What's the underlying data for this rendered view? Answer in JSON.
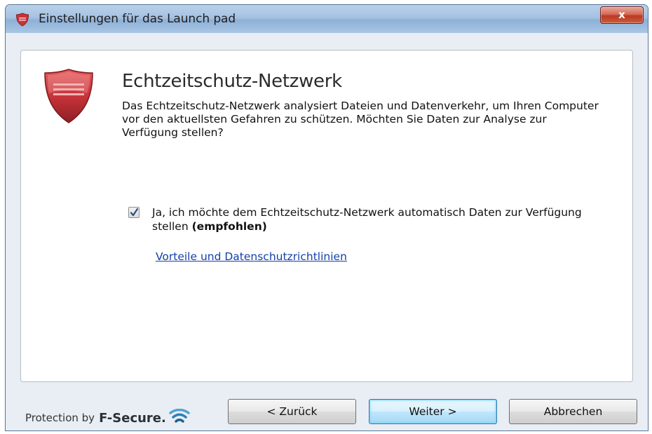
{
  "window": {
    "title": "Einstellungen für das Launch pad",
    "close_label": "x"
  },
  "content": {
    "heading": "Echtzeitschutz-Netzwerk",
    "description": "Das Echtzeitschutz-Netzwerk analysiert Dateien und Datenverkehr, um Ihren Computer vor den aktuellsten Gefahren zu schützen. Möchten Sie Daten zur Analyse zur Verfügung stellen?",
    "checkbox": {
      "checked": true,
      "label_main": "Ja, ich möchte dem Echtzeitschutz-Netzwerk automatisch Daten zur Verfügung stellen ",
      "label_bold": "(empfohlen)"
    },
    "link_text": "Vorteile und Datenschutzrichtlinien"
  },
  "footer": {
    "brand_prefix": "Protection by",
    "brand_name": "F-Secure.",
    "buttons": {
      "back": "< Zurück",
      "next": "Weiter >",
      "cancel": "Abbrechen"
    }
  },
  "icons": {
    "app": "shield-icon",
    "product": "shield-logo-icon",
    "brand": "f-secure-logo-icon",
    "check": "checkmark-icon"
  },
  "colors": {
    "accent_red": "#c8343a",
    "link_blue": "#1440a9",
    "titlebar_blue": "#a6c2e2"
  }
}
